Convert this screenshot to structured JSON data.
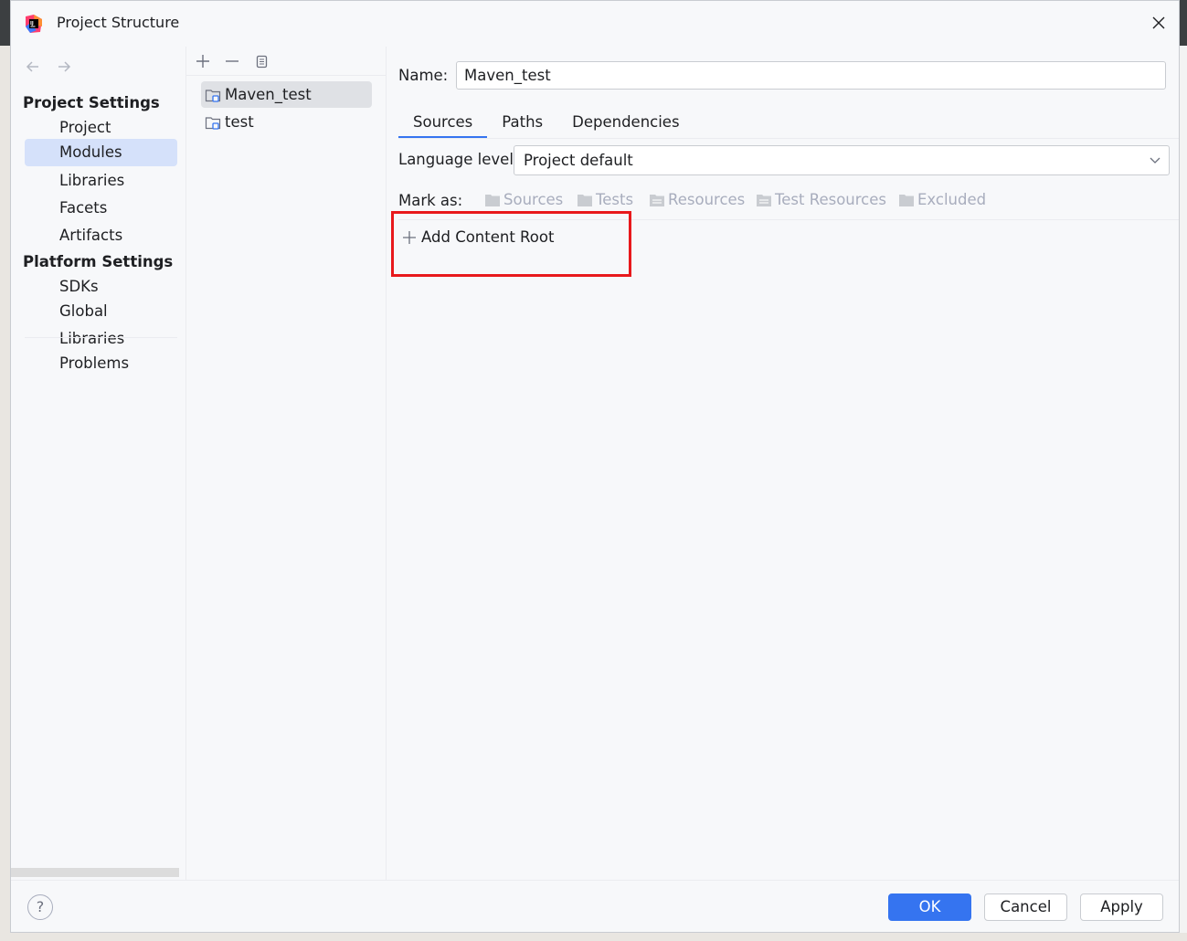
{
  "window": {
    "title": "Project Structure"
  },
  "nav": {
    "project_settings_header": "Project Settings",
    "platform_settings_header": "Platform Settings",
    "items": {
      "project": "Project",
      "modules": "Modules",
      "libraries": "Libraries",
      "facets": "Facets",
      "artifacts": "Artifacts",
      "sdks": "SDKs",
      "global_libraries": "Global Libraries",
      "problems": "Problems"
    },
    "selected": "Modules"
  },
  "modules": {
    "list": [
      "Maven_test",
      "test"
    ],
    "selected": "Maven_test"
  },
  "editor": {
    "name_label": "Name:",
    "name_value": "Maven_test",
    "tabs": [
      "Sources",
      "Paths",
      "Dependencies"
    ],
    "active_tab": "Sources",
    "language_level_label": "Language level:",
    "language_level_value": "Project default",
    "mark_as_label": "Mark as:",
    "mark_as": [
      "Sources",
      "Tests",
      "Resources",
      "Test Resources",
      "Excluded"
    ],
    "add_content_root": "Add Content Root"
  },
  "footer": {
    "help": "?",
    "ok": "OK",
    "cancel": "Cancel",
    "apply": "Apply"
  },
  "colors": {
    "accent": "#3574f0",
    "selection": "#d5e1fa",
    "highlight_box": "#e8191c"
  }
}
